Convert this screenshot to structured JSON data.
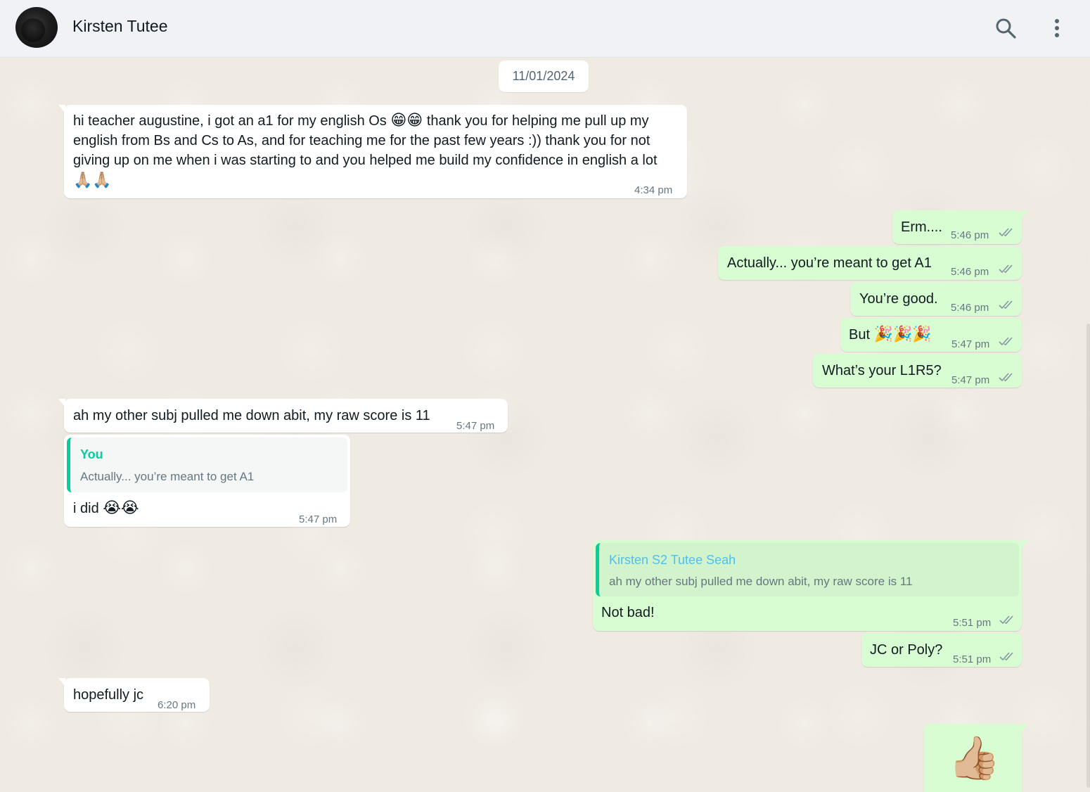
{
  "header": {
    "contact_name": "Kirsten Tutee",
    "icons": [
      "search-icon",
      "menu-dots-icon"
    ]
  },
  "date_divider": "11/01/2024",
  "colors": {
    "incoming_bubble": "#ffffff",
    "outgoing_bubble": "#d9fdd3",
    "chat_background": "#efeae2",
    "quote_accent": "#06cf9c",
    "read_ticks": "#53bdeb"
  },
  "messages": [
    {
      "direction": "in",
      "text_a": "hi teacher augustine, i got an a1 for my english Os",
      "emoji_a": "😁😁",
      "text_b": "thank you for helping me pull up my english from Bs and Cs to As, and for teaching me for the past few years :)) thank you for not giving up on me when i was starting to and you helped me build my confidence in english a lot",
      "emoji_b": "🙏🏼🙏🏼",
      "time": "4:34 pm"
    },
    {
      "direction": "out",
      "text": "Erm....",
      "time": "5:46 pm"
    },
    {
      "direction": "out",
      "text": "Actually... you’re meant to get A1",
      "time": "5:46 pm"
    },
    {
      "direction": "out",
      "text": "You’re good.",
      "time": "5:46 pm"
    },
    {
      "direction": "out",
      "text": "But",
      "emoji": "🎉🎉🎉",
      "time": "5:47 pm"
    },
    {
      "direction": "out",
      "text": "What’s your L1R5?",
      "time": "5:47 pm"
    },
    {
      "direction": "in",
      "text": "ah my other subj pulled me down abit, my raw score is 11",
      "time": "5:47 pm"
    },
    {
      "direction": "in",
      "quote_author": "You",
      "quote_text": "Actually... you’re meant to get A1",
      "text": "i did",
      "emoji": "😭😭",
      "time": "5:47 pm"
    },
    {
      "direction": "out",
      "quote_author": "Kirsten S2 Tutee Seah",
      "quote_text": "ah my other subj pulled me down abit, my raw score is 11",
      "text": "Not bad!",
      "time": "5:51 pm"
    },
    {
      "direction": "out",
      "text": "JC or Poly?",
      "time": "5:51 pm"
    },
    {
      "direction": "in",
      "text": "hopefully jc",
      "time": "6:20 pm"
    },
    {
      "direction": "out",
      "emoji": "👍🏼"
    }
  ]
}
